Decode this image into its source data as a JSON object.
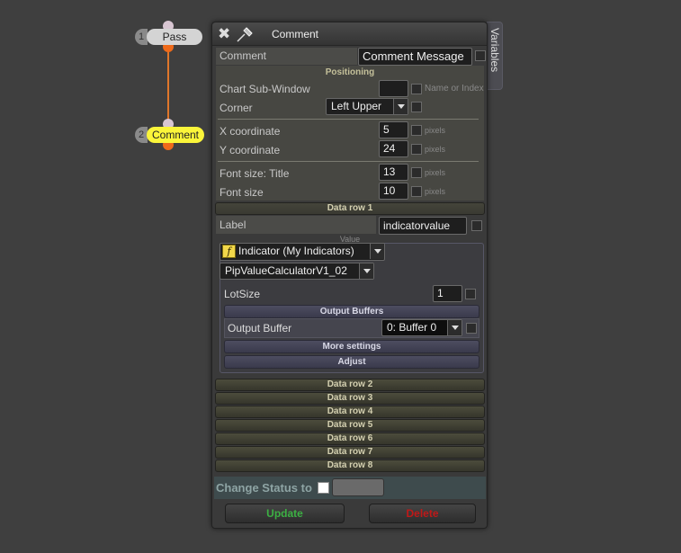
{
  "flow": {
    "nodes": [
      {
        "num": "1",
        "label": "Pass"
      },
      {
        "num": "2",
        "label": "Comment"
      }
    ]
  },
  "panel": {
    "title": "Comment",
    "side_tab": "Variables",
    "comment": {
      "label": "Comment",
      "value": "Comment Message"
    },
    "positioning": {
      "heading": "Positioning",
      "sub_window": {
        "label": "Chart Sub-Window",
        "value": "",
        "suffix": "Name or Index"
      },
      "corner": {
        "label": "Corner",
        "value": "Left Upper"
      },
      "x": {
        "label": "X coordinate",
        "value": "5",
        "unit": "pixels"
      },
      "y": {
        "label": "Y coordinate",
        "value": "24",
        "unit": "pixels"
      },
      "font_title": {
        "label": "Font size: Title",
        "value": "13",
        "unit": "pixels"
      },
      "font": {
        "label": "Font size",
        "value": "10",
        "unit": "pixels"
      }
    },
    "data_row_1": {
      "heading": "Data row 1",
      "label": {
        "label": "Label",
        "value": "indicatorvalue"
      },
      "value_heading": "Value",
      "indicator_type": "Indicator (My Indicators)",
      "indicator_name": "PipValueCalculatorV1_02",
      "lot_size": {
        "label": "LotSize",
        "value": "1"
      },
      "output_heading": "Output Buffers",
      "output_buffer": {
        "label": "Output Buffer",
        "value": "0: Buffer 0"
      },
      "more_settings": "More settings",
      "adjust": "Adjust"
    },
    "data_rows": [
      "Data row 2",
      "Data row 3",
      "Data row 4",
      "Data row 5",
      "Data row 6",
      "Data row 7",
      "Data row 8"
    ],
    "change_status_label": "Change Status to",
    "buttons": {
      "update": "Update",
      "delete": "Delete"
    }
  },
  "colors": {
    "update": "#3cb043",
    "delete": "#c01818",
    "node_active": "#fbf53a",
    "connector": "#e0762a"
  }
}
